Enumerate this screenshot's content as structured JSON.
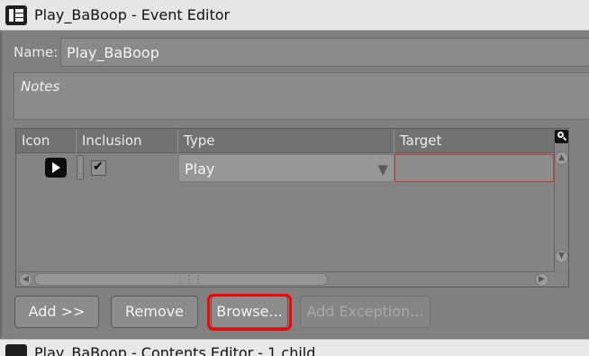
{
  "window": {
    "title": "Play_BaBoop - Event Editor",
    "app_icon": "event-editor-icon"
  },
  "form": {
    "name_label": "Name:",
    "name_value": "Play_BaBoop",
    "notes_placeholder": "Notes"
  },
  "grid": {
    "columns": [
      "Icon",
      "Inclusion",
      "Type",
      "Target"
    ],
    "rows": [
      {
        "icon": "play-icon",
        "inclusion": true,
        "type": "Play",
        "target": ""
      }
    ],
    "target_cell_error_color": "#c03a3a"
  },
  "buttons": {
    "add": "Add >>",
    "remove": "Remove",
    "browse": "Browse...",
    "add_exception": "Add Exception..."
  },
  "highlight_color": "#ff0000",
  "bottom_window": {
    "title": "Play_BaBoop - Contents Editor - 1 child"
  }
}
